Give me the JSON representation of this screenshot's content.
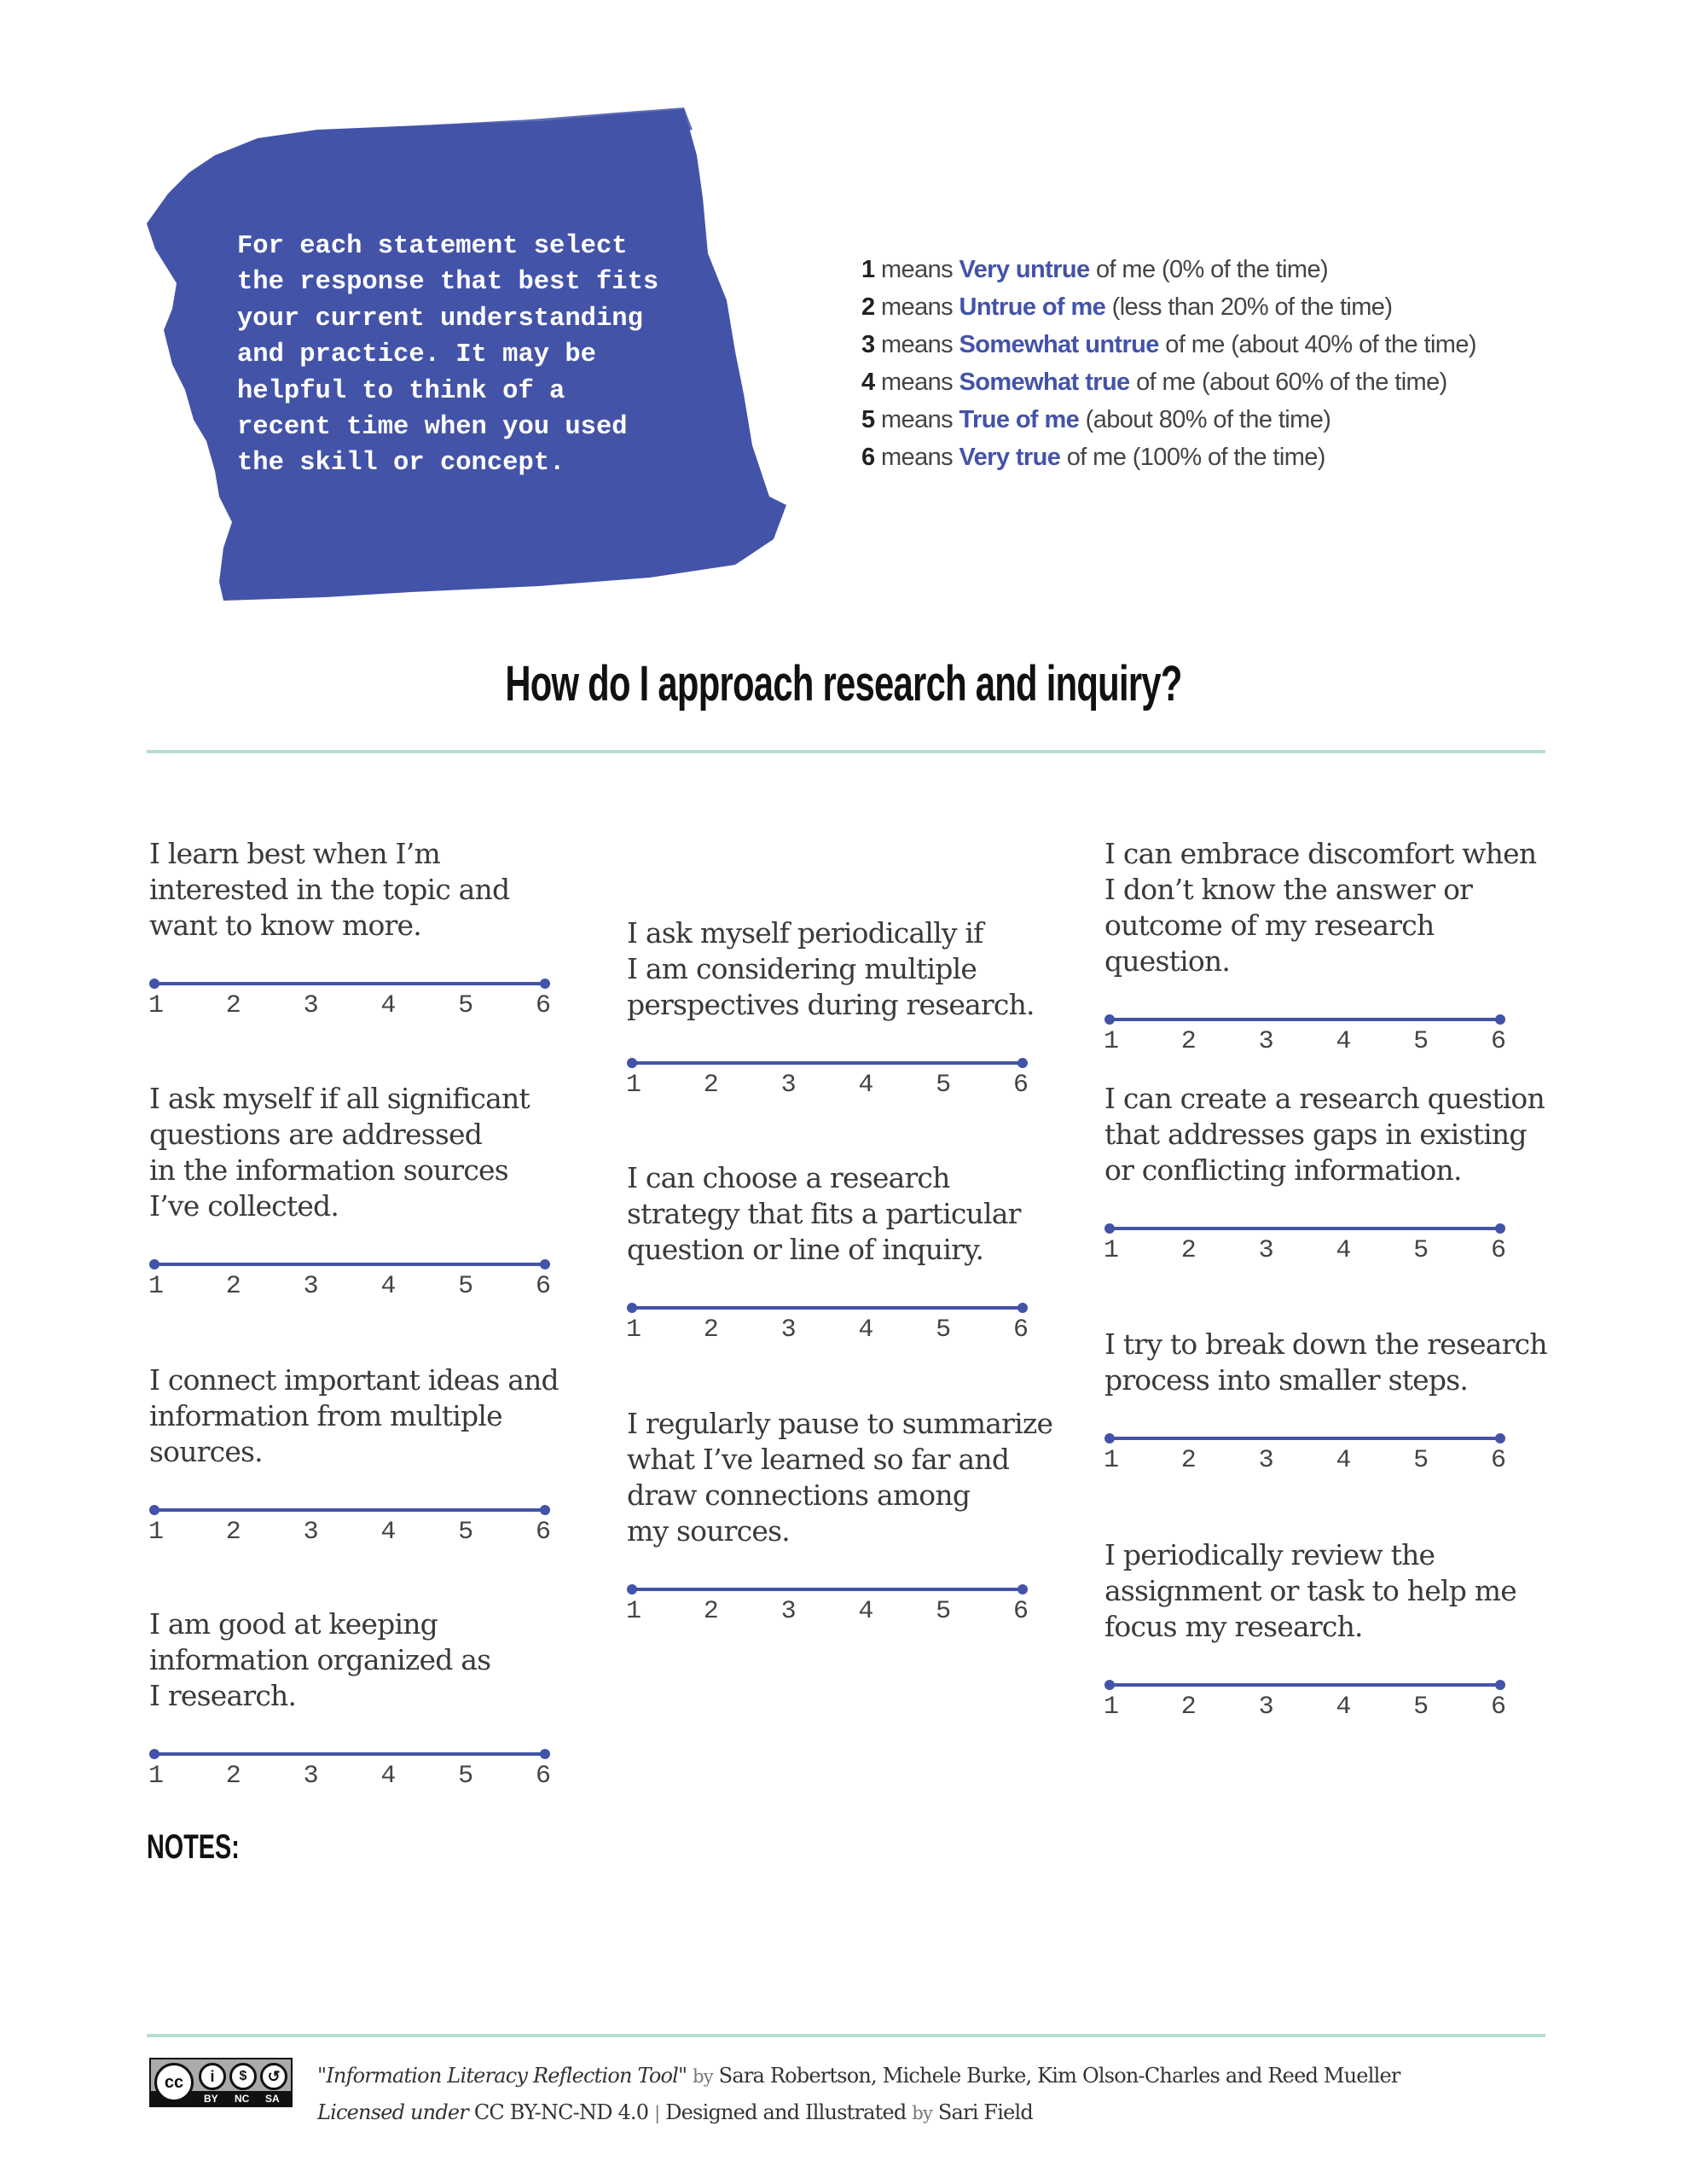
{
  "instructions": "For each statement select\nthe response that best fits\nyour current understanding\nand practice. It may be\nhelpful to think of a\nrecent time when you used\nthe skill or concept.",
  "legend": [
    {
      "num": "1",
      "means": "means",
      "key": "Very untrue",
      "rest": "of me (0% of the time)"
    },
    {
      "num": "2",
      "means": "means",
      "key": "Untrue of me",
      "rest": "(less than 20% of the time)"
    },
    {
      "num": "3",
      "means": "means",
      "key": "Somewhat untrue",
      "rest": "of me (about 40% of the time)"
    },
    {
      "num": "4",
      "means": "means",
      "key": "Somewhat true",
      "rest": "of me (about 60% of the time)"
    },
    {
      "num": "5",
      "means": "means",
      "key": "True of me",
      "rest": "(about 80% of the time)"
    },
    {
      "num": "6",
      "means": "means",
      "key": "Very true",
      "rest": "of me (100% of the time)"
    }
  ],
  "title": "How do I approach research and inquiry?",
  "scale_labels": [
    "1",
    "2",
    "3",
    "4",
    "5",
    "6"
  ],
  "columns": [
    [
      "I learn best when I’m\ninterested in the topic and\nwant to know more.",
      "I ask myself if all significant\nquestions are addressed\nin the information sources\nI’ve collected.",
      "I connect important ideas and\ninformation from multiple\nsources.",
      "I am good at keeping\ninformation organized as\nI research."
    ],
    [
      "I ask myself periodically if\nI am considering multiple\nperspectives during research.",
      "I can choose a research\nstrategy that fits a particular\nquestion or line of inquiry.",
      "I regularly pause to summarize\nwhat I’ve learned so far and\ndraw connections among\nmy sources."
    ],
    [
      "I can embrace discomfort when\nI don’t know the answer or\noutcome of my research question.",
      "I can create a research question\nthat addresses gaps in existing\nor conflicting information.",
      "I try to break down the research\nprocess into smaller steps.",
      "I periodically review the\nassignment or task to help me\nfocus my research."
    ]
  ],
  "notes_label": "NOTES:",
  "footer": {
    "cc_icons": [
      "cc",
      "by",
      "nc",
      "sa"
    ],
    "cc_labels": [
      "BY",
      "NC",
      "SA"
    ],
    "work_title": "\"Information Literacy Reflection Tool\"",
    "by": "by",
    "authors": "Sara Robertson, Michele Burke, Kim Olson-Charles and Reed Mueller",
    "licensed_under": "Licensed under",
    "license": "CC BY-NC-ND 4.0",
    "separator": "|",
    "designed": "Designed and Illustrated",
    "by2": "by",
    "designer": "Sari Field"
  },
  "colors": {
    "accent": "#4353a8",
    "rule": "#b6dfd1",
    "text": "#333333"
  }
}
